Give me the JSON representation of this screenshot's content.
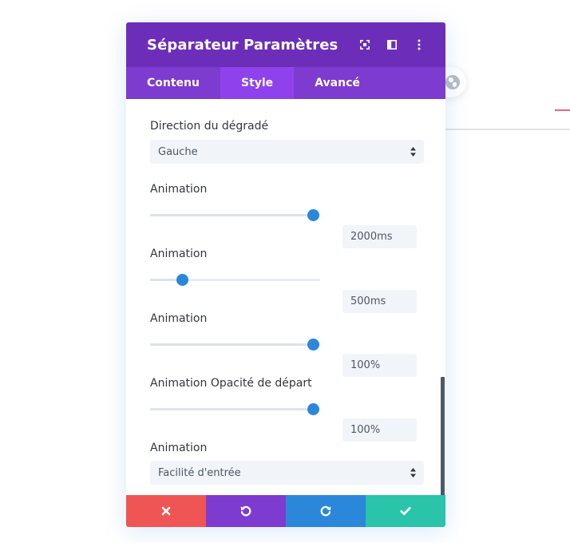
{
  "header": {
    "title": "Séparateur Paramètres",
    "icons": [
      "expand-icon",
      "split-view-icon",
      "more-options-icon"
    ]
  },
  "tabs": [
    {
      "label": "Contenu",
      "active": false
    },
    {
      "label": "Style",
      "active": true
    },
    {
      "label": "Avancé",
      "active": false
    }
  ],
  "fields": {
    "gradient_direction": {
      "label": "Direction du dégradé",
      "value": "Gauche"
    },
    "animation_duration": {
      "label": "Animation",
      "value": "2000ms",
      "slider_fraction": 0.96
    },
    "animation_delay": {
      "label": "Animation",
      "value": "500ms",
      "slider_fraction": 0.19
    },
    "animation_intensity": {
      "label": "Animation",
      "value": "100%",
      "slider_fraction": 0.96
    },
    "animation_opacity": {
      "label": "Animation Opacité de départ",
      "value": "100%",
      "slider_fraction": 0.96
    },
    "animation_easing": {
      "label": "Animation",
      "value": "Facilité d'entrée"
    }
  },
  "footer": {
    "buttons": [
      "cancel-icon",
      "undo-icon",
      "redo-icon",
      "save-check-icon"
    ]
  },
  "colors": {
    "header": "#6c2eb9",
    "tabs": "#7d3bcf",
    "tab_active": "#8f42ec",
    "accent_blue": "#2b87da",
    "cancel_red": "#ef5555",
    "undo_purple": "#7e3bd0",
    "redo_blue": "#2b87da",
    "save_green": "#29c4a9"
  }
}
